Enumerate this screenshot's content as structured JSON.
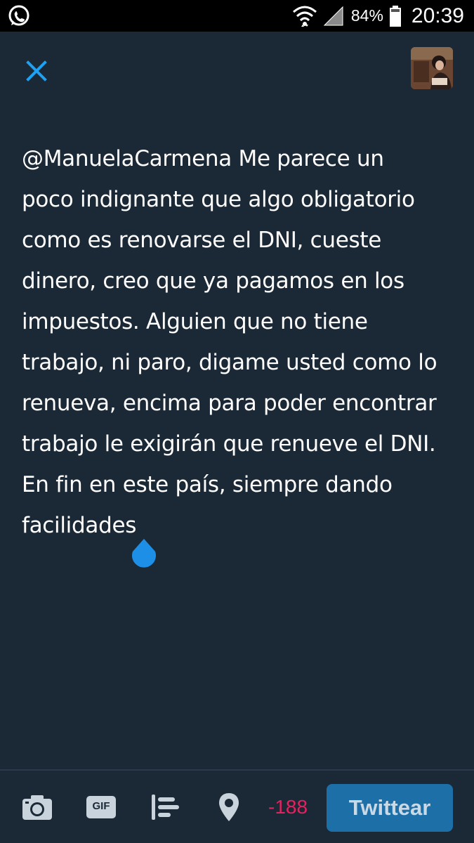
{
  "status_bar": {
    "battery_percent": "84%",
    "time": "20:39",
    "icons": [
      "whatsapp-icon",
      "wifi-icon",
      "signal-icon",
      "battery-icon"
    ]
  },
  "compose": {
    "close_icon": "close-icon",
    "tweet_lines": [
      "@ManuelaCarmena Me parece un",
      "poco indignante que algo obligatorio",
      "como es renovarse el DNI, cueste",
      "dinero, creo que ya pagamos en los",
      "impuestos. Alguien que no tiene",
      "trabajo, ni paro, digame usted como lo",
      "renueva, encima para poder encontrar",
      "trabajo le exigirán que renueve el DNI.",
      "En fin en este país, siempre dando",
      "facilidades"
    ]
  },
  "toolbar": {
    "icons": [
      "camera-icon",
      "gif-icon",
      "poll-icon",
      "location-icon"
    ],
    "gif_label": "GIF",
    "char_count": "-188",
    "tweet_button": "Twittear"
  },
  "colors": {
    "background": "#1b2836",
    "accent": "#1da1f2",
    "button": "#1d6fa8",
    "over_limit": "#e0245e"
  }
}
